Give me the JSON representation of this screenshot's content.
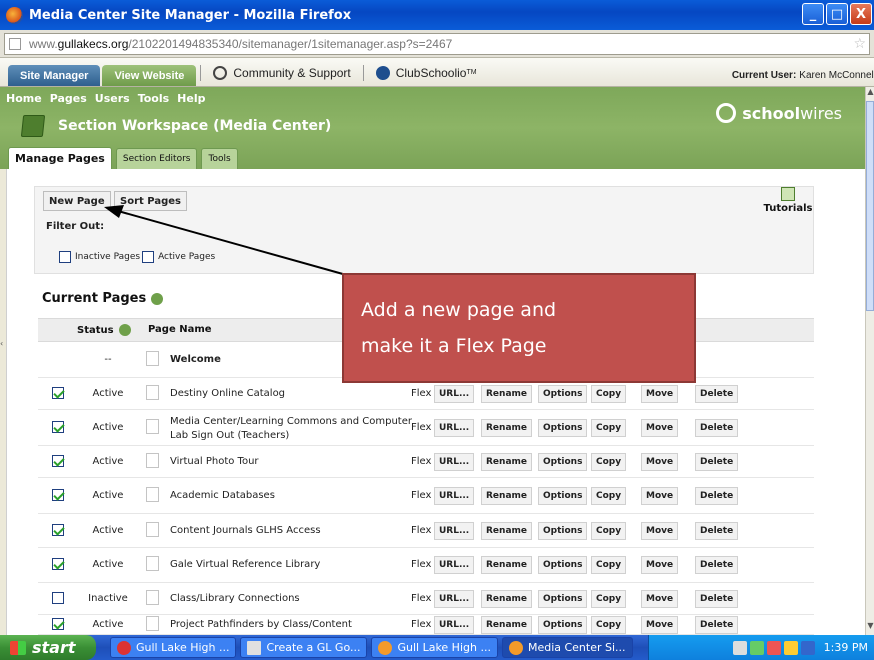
{
  "window": {
    "title": "Media Center Site Manager - Mozilla Firefox",
    "buttons": {
      "minimize": "_",
      "maximize": "□",
      "close": "X"
    }
  },
  "address_bar": {
    "prefix": "www.",
    "domain": "gullakecs.org",
    "path": "/2102201494835340/sitemanager/1sitemanager.asp?s=2467"
  },
  "top_strip": {
    "tabs": [
      "Site Manager",
      "View Website"
    ],
    "links": [
      "Community & Support",
      "ClubSchoolio"
    ],
    "trademark": "TM",
    "current_user_label": "Current User:",
    "current_user_name": "Karen McConnell"
  },
  "menu": [
    "Home",
    "Pages",
    "Users",
    "Tools",
    "Help"
  ],
  "workspace_title": "Section Workspace (Media Center)",
  "logo": {
    "bold": "school",
    "thin": "wires"
  },
  "sub_tabs": [
    "Manage Pages",
    "Section Editors",
    "Tools"
  ],
  "toolbox": {
    "new_page": "New Page",
    "sort_pages": "Sort Pages",
    "filter_label": "Filter Out:",
    "filter_inactive": "Inactive Pages",
    "filter_active": "Active Pages",
    "tutorials": "Tutorials"
  },
  "current_pages_title": "Current Pages",
  "table": {
    "headers": {
      "status": "Status",
      "page_name": "Page Name"
    },
    "actions": [
      "URL...",
      "Rename",
      "Options",
      "Copy",
      "Move",
      "Delete"
    ],
    "rows": [
      {
        "status": "--",
        "name": "Welcome",
        "type": ""
      },
      {
        "status": "Active",
        "name": "Destiny Online Catalog",
        "type": "Flex Page"
      },
      {
        "status": "Active",
        "name": "Media Center/Learning Commons and Computer Lab Sign Out (Teachers)",
        "type": "Flex Page"
      },
      {
        "status": "Active",
        "name": "Virtual Photo Tour",
        "type": "Flex Page"
      },
      {
        "status": "Active",
        "name": "Academic Databases",
        "type": "Flex Page"
      },
      {
        "status": "Active",
        "name": "Content Journals GLHS Access",
        "type": "Flex Page"
      },
      {
        "status": "Active",
        "name": "Gale Virtual Reference Library",
        "type": "Flex Page"
      },
      {
        "status": "Inactive",
        "name": "Class/Library Connections",
        "type": "Flex Page"
      },
      {
        "status": "Active",
        "name": "Project Pathfinders by Class/Content",
        "type": "Flex Page"
      }
    ]
  },
  "callout": {
    "line1": "Add a new page and",
    "line2": "make it a Flex Page"
  },
  "taskbar": {
    "start": "start",
    "tasks": [
      "Gull Lake High ...",
      "Create a GL Go...",
      "Gull Lake High ...",
      "Media Center Si..."
    ],
    "clock": "1:39 PM"
  }
}
